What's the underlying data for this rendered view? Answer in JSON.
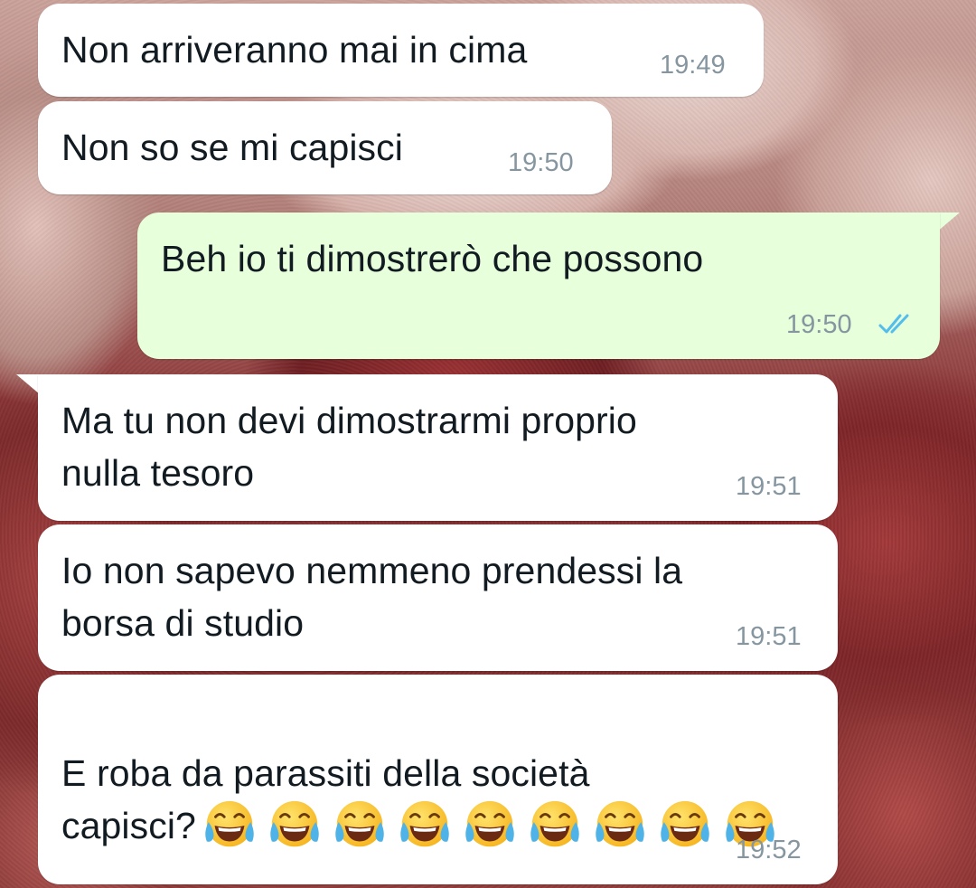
{
  "chat": {
    "messages": [
      {
        "direction": "incoming",
        "text": "Non arriveranno mai in cima",
        "time": "19:49"
      },
      {
        "direction": "incoming",
        "text": "Non so se mi capisci",
        "time": "19:50"
      },
      {
        "direction": "outgoing",
        "text": "Beh io ti dimostrerò che possono",
        "time": "19:50",
        "status": "read-double-check-icon"
      },
      {
        "direction": "incoming",
        "text": "Ma tu non devi dimostrarmi proprio\nnulla tesoro",
        "time": "19:51"
      },
      {
        "direction": "incoming",
        "text": "Io non sapevo nemmeno prendessi la\nborsa di studio",
        "time": "19:51"
      },
      {
        "direction": "incoming",
        "text": "E roba da parassiti della società\ncapisci?",
        "emoji": "face-with-tears-of-joy-icon",
        "emoji_count": 9,
        "time": "19:52"
      }
    ]
  },
  "colors": {
    "incoming_bubble": "#ffffff",
    "outgoing_bubble": "#e7ffdb",
    "timestamp": "#8696a0",
    "read_ticks": "#53bdeb",
    "text": "#111b21"
  }
}
